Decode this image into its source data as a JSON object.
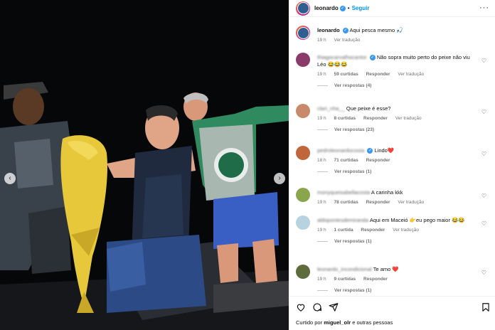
{
  "post": {
    "username": "leonardo",
    "follow_label": "Seguir",
    "caption": "Aqui pesca mesmo 🎣",
    "caption_time": "19 h",
    "caption_translate": "Ver tradução",
    "image_alt": "Photo: three men on a boat at night holding a large yellow catfish"
  },
  "comments": [
    {
      "user": "thiagocarvalhocantor",
      "text": "Não sopra muito perto do peixe não viu Léo 😂😂😂",
      "time": "19 h",
      "likes": "59 curtidas",
      "reply": "Responder",
      "translate": "Ver tradução",
      "replies": "Ver respostas (4)",
      "avatar_color": "#8a3b6a"
    },
    {
      "user": "clari_nha__",
      "text": "Que peixe é esse?",
      "time": "19 h",
      "likes": "8 curtidas",
      "reply": "Responder",
      "translate": "Ver tradução",
      "replies": "Ver respostas (23)",
      "avatar_color": "#c98a6b"
    },
    {
      "user": "pedroleonardocosta",
      "text": "Lindo❤️",
      "time": "18 h",
      "likes": "71 curtidas",
      "reply": "Responder",
      "translate": "",
      "replies": "Ver respostas (1)",
      "avatar_color": "#c1663a"
    },
    {
      "user": "monyqueisabellacosta",
      "text": "A carinha kkk",
      "time": "19 h",
      "likes": "78 curtidas",
      "reply": "Responder",
      "translate": "Ver tradução",
      "replies": "",
      "avatar_color": "#8aa64c"
    },
    {
      "user": "aldopontesdemiranda",
      "text": "Aqui em Maceió 👉eu pego maior 😂😂",
      "time": "19 h",
      "likes": "1 curtida",
      "reply": "Responder",
      "translate": "Ver tradução",
      "replies": "Ver respostas (1)",
      "avatar_color": "#b7d3e0"
    },
    {
      "user": "leonardo_incondicional",
      "text": "Te amo ❤️",
      "time": "19 h",
      "likes": "9 curtidas",
      "reply": "Responder",
      "translate": "",
      "replies": "Ver respostas (1)",
      "avatar_color": "#5e6b3b"
    }
  ],
  "footer": {
    "liked_by_prefix": "Curtido por",
    "liked_by_user": "miguel_olr",
    "liked_by_suffix": "e outras pessoas"
  },
  "icons": {
    "verified": "verified-badge-icon",
    "heart": "heart-icon",
    "comment": "comment-icon",
    "share": "share-icon",
    "bookmark": "bookmark-icon",
    "more": "more-options-icon",
    "prev": "chevron-left-icon",
    "next": "chevron-right-icon"
  },
  "colors": {
    "accent": "#0095f6",
    "verified": "#3897f0",
    "muted_text": "#737373"
  }
}
